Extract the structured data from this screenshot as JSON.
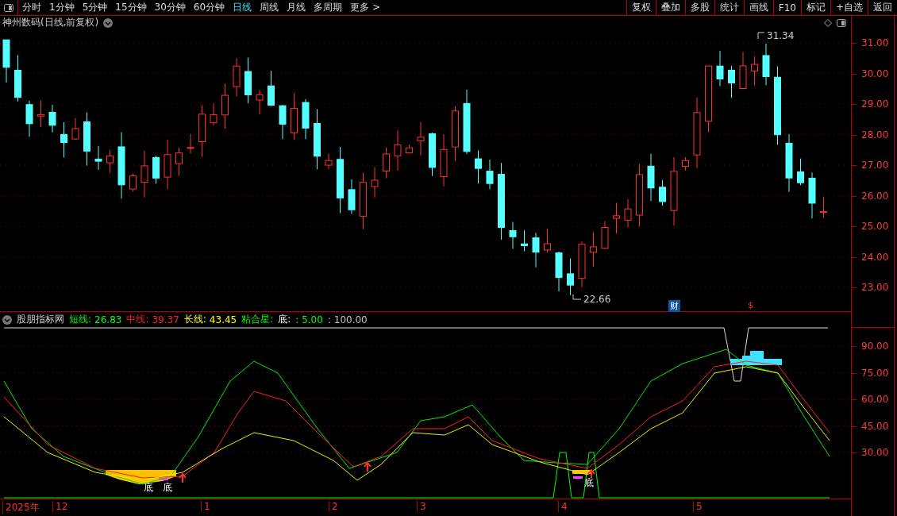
{
  "toolbar": {
    "periods": [
      {
        "label": "分时",
        "selected": false
      },
      {
        "label": "1分钟",
        "selected": false
      },
      {
        "label": "5分钟",
        "selected": false
      },
      {
        "label": "15分钟",
        "selected": false
      },
      {
        "label": "30分钟",
        "selected": false
      },
      {
        "label": "60分钟",
        "selected": false
      },
      {
        "label": "日线",
        "selected": true
      },
      {
        "label": "周线",
        "selected": false
      },
      {
        "label": "月线",
        "selected": false
      },
      {
        "label": "多周期",
        "selected": false
      },
      {
        "label": "更多 >",
        "selected": false
      }
    ],
    "buttons": [
      "复权",
      "叠加",
      "多股",
      "统计",
      "画线",
      "F10",
      "标记",
      "+自选",
      "返回"
    ]
  },
  "chart_title": "神州数码(日线,前复权)",
  "price_axis": [
    "31.00",
    "30.00",
    "29.00",
    "28.00",
    "27.00",
    "26.00",
    "25.00",
    "24.00",
    "23.00"
  ],
  "high_label": "31.34",
  "low_label": "22.66",
  "markers": [
    {
      "kind": "finance",
      "text": "财"
    },
    {
      "kind": "dollar",
      "text": "$"
    }
  ],
  "indicator": {
    "name": "股朋指标网",
    "legend": [
      {
        "kind": "series",
        "label": "短线:",
        "value": "26.83",
        "color": "#00ff00"
      },
      {
        "kind": "series",
        "label": "中线:",
        "value": "39.37",
        "color": "#ff2020"
      },
      {
        "kind": "series",
        "label": "长线:",
        "value": "43.45",
        "color": "#ffff00"
      },
      {
        "kind": "signal",
        "label": "粘合星:"
      },
      {
        "kind": "plain",
        "label": "底:"
      },
      {
        "kind": "value",
        "value": ": 5.00",
        "color": "#00ff00"
      },
      {
        "kind": "value",
        "value": ": 100.00",
        "color": "#c0c0c0"
      }
    ],
    "axis": [
      "90.00",
      "75.00",
      "60.00",
      "45.00",
      "30.00"
    ],
    "signals": [
      "底",
      "底",
      "底"
    ]
  },
  "date_axis": [
    "2025年",
    "12",
    "1",
    "2",
    "3",
    "4",
    "5"
  ]
}
